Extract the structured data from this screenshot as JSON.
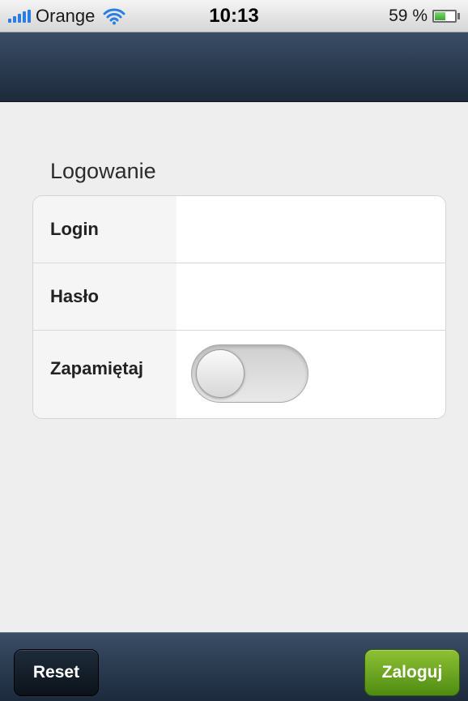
{
  "status_bar": {
    "carrier": "Orange",
    "time": "10:13",
    "battery_percent": "59 %",
    "battery_level": 0.59
  },
  "form": {
    "title": "Logowanie",
    "fields": {
      "login_label": "Login",
      "login_value": "",
      "password_label": "Hasło",
      "password_value": "",
      "remember_label": "Zapamiętaj",
      "remember_on": false
    }
  },
  "toolbar": {
    "reset_label": "Reset",
    "login_label": "Zaloguj"
  },
  "colors": {
    "nav_bar": "#2b3b50",
    "login_button": "#6fa924",
    "background": "#eeeeee"
  },
  "icons": [
    "signal-icon",
    "wifi-icon",
    "battery-icon"
  ]
}
